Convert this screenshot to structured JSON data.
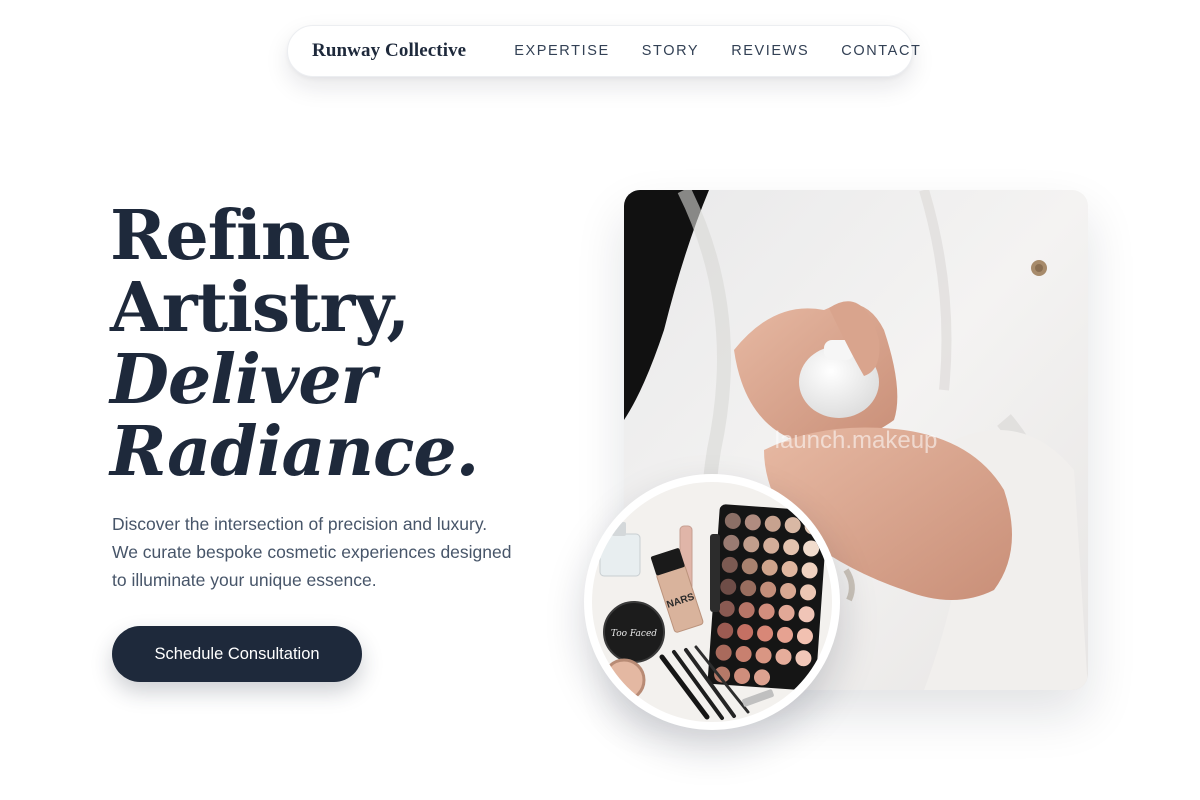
{
  "nav": {
    "brand": "Runway Collective",
    "links": [
      {
        "label": "EXPERTISE"
      },
      {
        "label": "STORY"
      },
      {
        "label": "REVIEWS"
      },
      {
        "label": "CONTACT"
      }
    ]
  },
  "hero": {
    "headline": {
      "line1": "Refine",
      "line2": "Artistry,",
      "line3": "Deliver",
      "line4": "Radiance."
    },
    "description": {
      "line1": "Discover the intersection of precision and luxury.",
      "line2": "We curate bespoke cosmetic experiences designed",
      "line3": "to illuminate your unique essence."
    },
    "cta_label": "Schedule Consultation"
  },
  "images": {
    "main": {
      "watermark": "launch.makeup",
      "icon": "hands-lotion-photo"
    },
    "circle": {
      "icon": "makeup-products-photo",
      "compact_text": "Too Faced",
      "bottle_text": "NARS"
    }
  },
  "colors": {
    "primary": "#1e293b",
    "text_muted": "#475569",
    "background": "#ffffff"
  }
}
